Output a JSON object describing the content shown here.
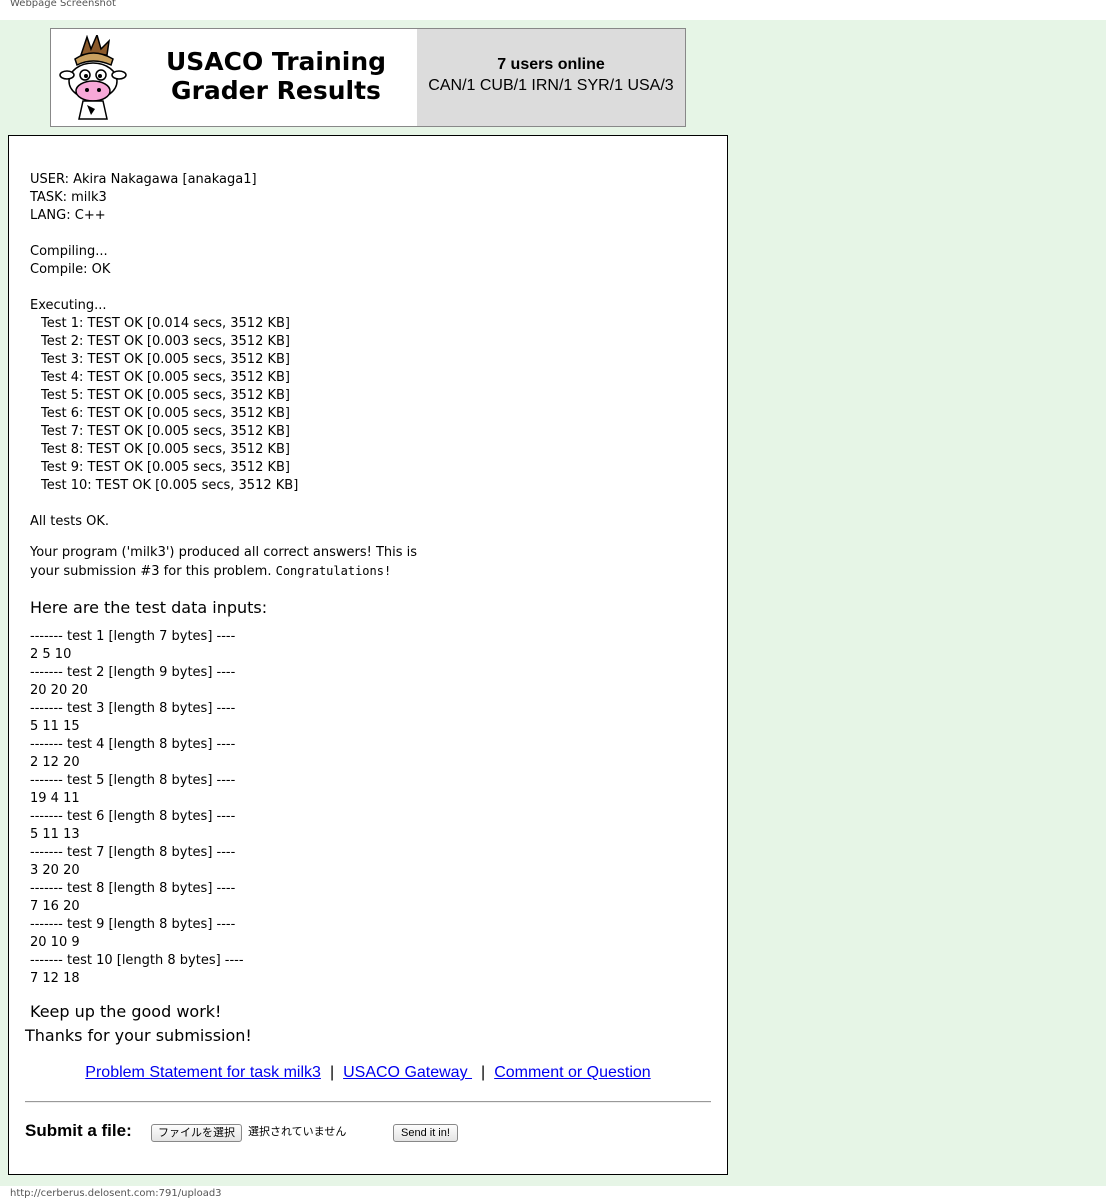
{
  "window": {
    "title": "Webpage Screenshot",
    "status_url": "http://cerberus.delosent.com:791/upload3"
  },
  "header": {
    "title_line1": "USACO Training",
    "title_line2": "Grader Results",
    "online_count": "7 users online",
    "online_countries": "CAN/1 CUB/1 IRN/1 SYR/1 USA/3"
  },
  "report": {
    "user": "USER: Akira Nakagawa [anakaga1]",
    "task": "TASK: milk3",
    "lang": "LANG: C++",
    "compiling": "Compiling...",
    "compile_status": "Compile: OK",
    "executing": "Executing...",
    "tests": [
      "Test 1: TEST OK [0.014 secs, 3512 KB]",
      "Test 2: TEST OK [0.003 secs, 3512 KB]",
      "Test 3: TEST OK [0.005 secs, 3512 KB]",
      "Test 4: TEST OK [0.005 secs, 3512 KB]",
      "Test 5: TEST OK [0.005 secs, 3512 KB]",
      "Test 6: TEST OK [0.005 secs, 3512 KB]",
      "Test 7: TEST OK [0.005 secs, 3512 KB]",
      "Test 8: TEST OK [0.005 secs, 3512 KB]",
      "Test 9: TEST OK [0.005 secs, 3512 KB]",
      "Test 10: TEST OK [0.005 secs, 3512 KB]"
    ],
    "all_ok": "All tests OK.",
    "summary_text": "Your program ('milk3') produced all correct answers!  This is your submission #3 for this problem. ",
    "congrats": "Congratulations!",
    "inputs_heading": "Here are the test data inputs:",
    "test_inputs": [
      {
        "header": "------- test 1 [length 7 bytes] ----",
        "data": "2 5 10"
      },
      {
        "header": "------- test 2 [length 9 bytes] ----",
        "data": "20 20 20"
      },
      {
        "header": "------- test 3 [length 8 bytes] ----",
        "data": "5 11 15"
      },
      {
        "header": "------- test 4 [length 8 bytes] ----",
        "data": "2 12 20"
      },
      {
        "header": "------- test 5 [length 8 bytes] ----",
        "data": "19 4 11"
      },
      {
        "header": "------- test 6 [length 8 bytes] ----",
        "data": "5 11 13"
      },
      {
        "header": "------- test 7 [length 8 bytes] ----",
        "data": "3 20 20"
      },
      {
        "header": "------- test 8 [length 8 bytes] ----",
        "data": "7 16 20"
      },
      {
        "header": "------- test 9 [length 8 bytes] ----",
        "data": "20 10 9"
      },
      {
        "header": "------- test 10 [length 8 bytes] ----",
        "data": "7 12 18"
      }
    ],
    "keep_up": "Keep up the good work!",
    "thanks": "Thanks for your submission!"
  },
  "links": {
    "problem_statement": "Problem Statement for task milk3",
    "separator": "|",
    "gateway": "USACO Gateway ",
    "comment": "Comment or Question"
  },
  "submit": {
    "label": "Submit a file:",
    "choose_file": "ファイルを選択",
    "no_file": "選択されていません",
    "send": "Send it in!"
  },
  "colors": {
    "page_bg": "#e6f5e6",
    "link": "#0000ee",
    "online_panel": "#dcdcdc"
  }
}
